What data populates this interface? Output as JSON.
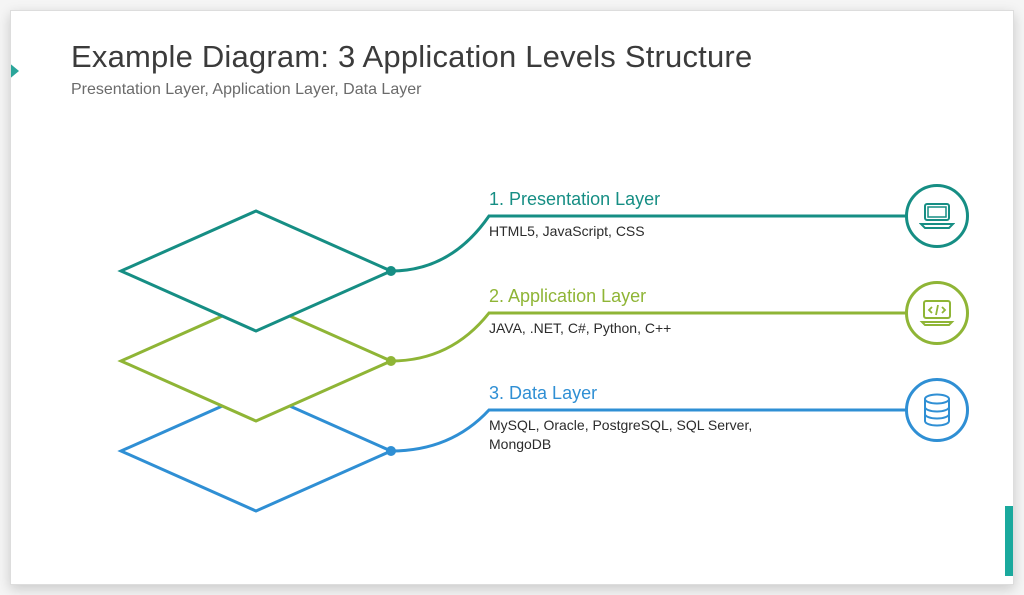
{
  "header": {
    "title": "Example Diagram: 3 Application Levels Structure",
    "subtitle": "Presentation Layer, Application Layer, Data Layer"
  },
  "layers": [
    {
      "number": "1.",
      "name": "Presentation Layer",
      "desc": "HTML5, JavaScript, CSS",
      "color": "#168e84",
      "icon": "laptop"
    },
    {
      "number": "2.",
      "name": "Application Layer",
      "desc": "JAVA, .NET, C#, Python, C++",
      "color": "#8fb536",
      "icon": "code-laptop"
    },
    {
      "number": "3.",
      "name": "Data Layer",
      "desc": "MySQL, Oracle, PostgreSQL, SQL Server, MongoDB",
      "color": "#2f8fd4",
      "icon": "database"
    }
  ]
}
